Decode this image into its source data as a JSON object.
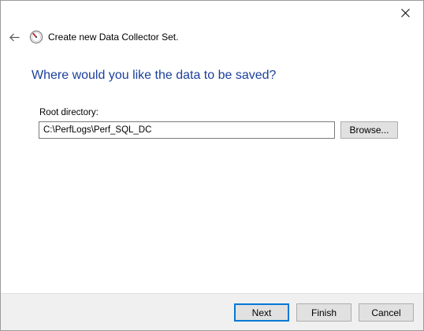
{
  "window": {
    "close_icon": "close-icon"
  },
  "header": {
    "back_icon": "back-arrow-icon",
    "app_icon": "performance-monitor-icon",
    "title": "Create new Data Collector Set."
  },
  "main": {
    "heading": "Where would you like the data to be saved?",
    "root_directory_label": "Root directory:",
    "root_directory_value": "C:\\PerfLogs\\Perf_SQL_DC",
    "browse_label": "Browse..."
  },
  "footer": {
    "next_label": "Next",
    "finish_label": "Finish",
    "cancel_label": "Cancel"
  },
  "colors": {
    "heading": "#1b3f9c",
    "focus_border": "#0078d7",
    "button_face": "#e1e1e1",
    "footer_bg": "#f0f0f0"
  }
}
